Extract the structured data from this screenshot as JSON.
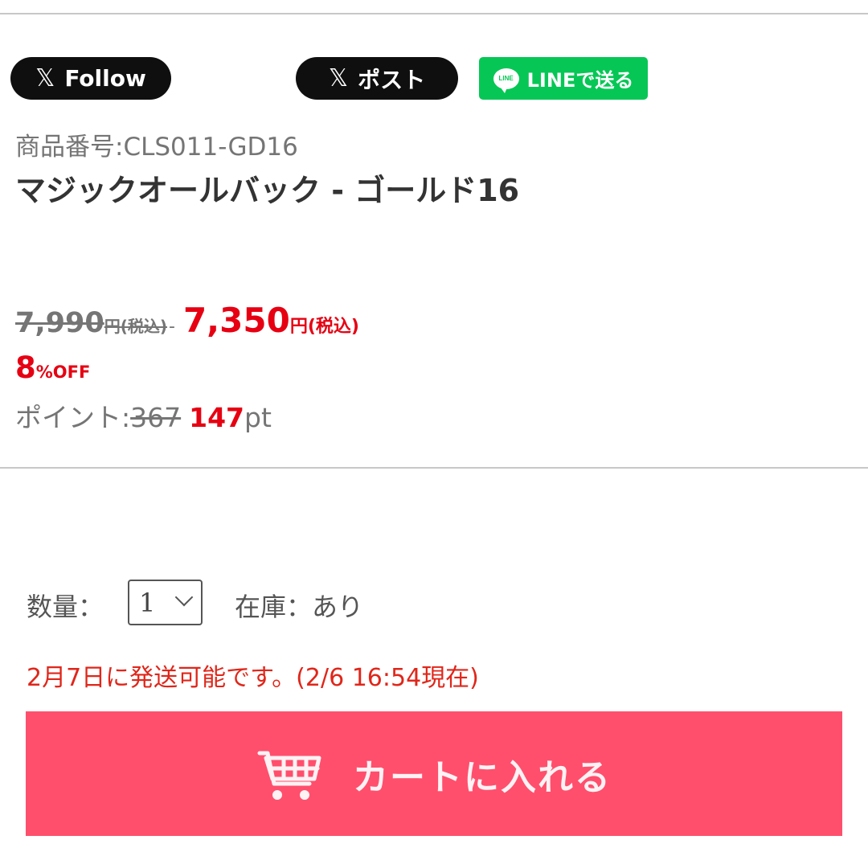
{
  "share": {
    "x_follow_label": "Follow",
    "x_post_label": "ポスト",
    "x_glyph": "𝕏",
    "line_label": "LINEで送る",
    "line_icon_text": "LINE"
  },
  "product": {
    "code": "商品番号:CLS011-GD16",
    "name": "マジックオールバック - ゴールド16"
  },
  "price": {
    "old_value": "7,990",
    "old_suffix": "円(税込)",
    "separator": "-",
    "new_value": "7,350",
    "new_suffix": "円(税込)"
  },
  "discount": {
    "value": "8",
    "unit": "%OFF"
  },
  "points": {
    "label": "ポイント:",
    "old": "367",
    "new": "147",
    "unit": "pt"
  },
  "purchase": {
    "quantity_label": "数量：",
    "quantity_value": "1",
    "stock_text": "在庫：あり",
    "shipping_text": "2月7日に発送可能です。(2/6 16:54現在)",
    "cart_label": "カートに入れる"
  },
  "colors": {
    "accent_red": "#e60012",
    "cart_button": "#ff4f6d",
    "line_green": "#06c755",
    "x_black": "#0f0f0f"
  },
  "icons": {
    "x_logo": "x-logo-icon",
    "line_logo": "line-logo-icon",
    "cart": "shopping-cart-icon",
    "select_chevron": "chevron-down-icon"
  }
}
